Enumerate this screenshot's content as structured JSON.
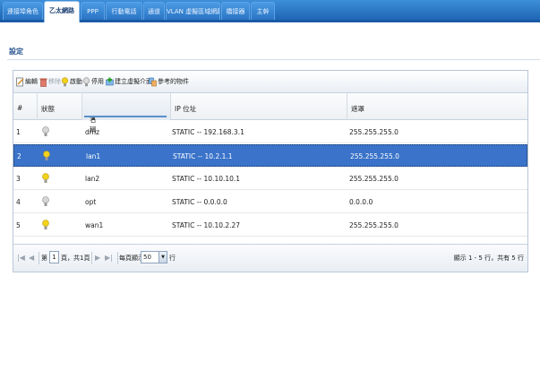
{
  "tabs": [
    {
      "label": "連接埠角色",
      "active": false
    },
    {
      "label": "乙太網路",
      "active": true
    },
    {
      "label": "PPP",
      "active": false
    },
    {
      "label": "行動電話",
      "active": false
    },
    {
      "label": "通道",
      "active": false
    },
    {
      "label": "VLAN 虛擬區域網路",
      "active": false
    },
    {
      "label": "橋接器",
      "active": false
    },
    {
      "label": "主幹",
      "active": false
    }
  ],
  "section": {
    "title": "設定"
  },
  "toolbar": {
    "edit": "編輯",
    "delete": "移除",
    "activate": "啟動",
    "deactivate": "停用",
    "create_virtual": "建立虛擬介面",
    "references": "參考的物件"
  },
  "table": {
    "columns": [
      "#",
      "狀態",
      "名稱",
      "IP 位址",
      "遮罩"
    ],
    "rows": [
      {
        "num": "1",
        "status": "off",
        "name": "dmz",
        "ip": "STATIC -- 192.168.3.1",
        "mask": "255.255.255.0",
        "selected": false
      },
      {
        "num": "2",
        "status": "on",
        "name": "lan1",
        "ip": "STATIC -- 10.2.1.1",
        "mask": "255.255.255.0",
        "selected": true
      },
      {
        "num": "3",
        "status": "on",
        "name": "lan2",
        "ip": "STATIC -- 10.10.10.1",
        "mask": "255.255.255.0",
        "selected": false
      },
      {
        "num": "4",
        "status": "off",
        "name": "opt",
        "ip": "STATIC -- 0.0.0.0",
        "mask": "0.0.0.0",
        "selected": false
      },
      {
        "num": "5",
        "status": "on",
        "name": "wan1",
        "ip": "STATIC -- 10.10.2.27",
        "mask": "255.255.255.0",
        "selected": false
      }
    ]
  },
  "pager": {
    "page_prefix": "第",
    "page_value": "1",
    "page_suffix": "頁，共1頁",
    "per_page_label": "每頁顯示",
    "per_page_value": "50",
    "per_page_unit": "行",
    "summary": "顯示 1 - 5 行，共有 5 行"
  },
  "colors": {
    "accent": "#1f66b5",
    "selected_row": "#3a73c9",
    "bulb_on": "#f2d21c",
    "bulb_off": "#c8c8c8"
  }
}
